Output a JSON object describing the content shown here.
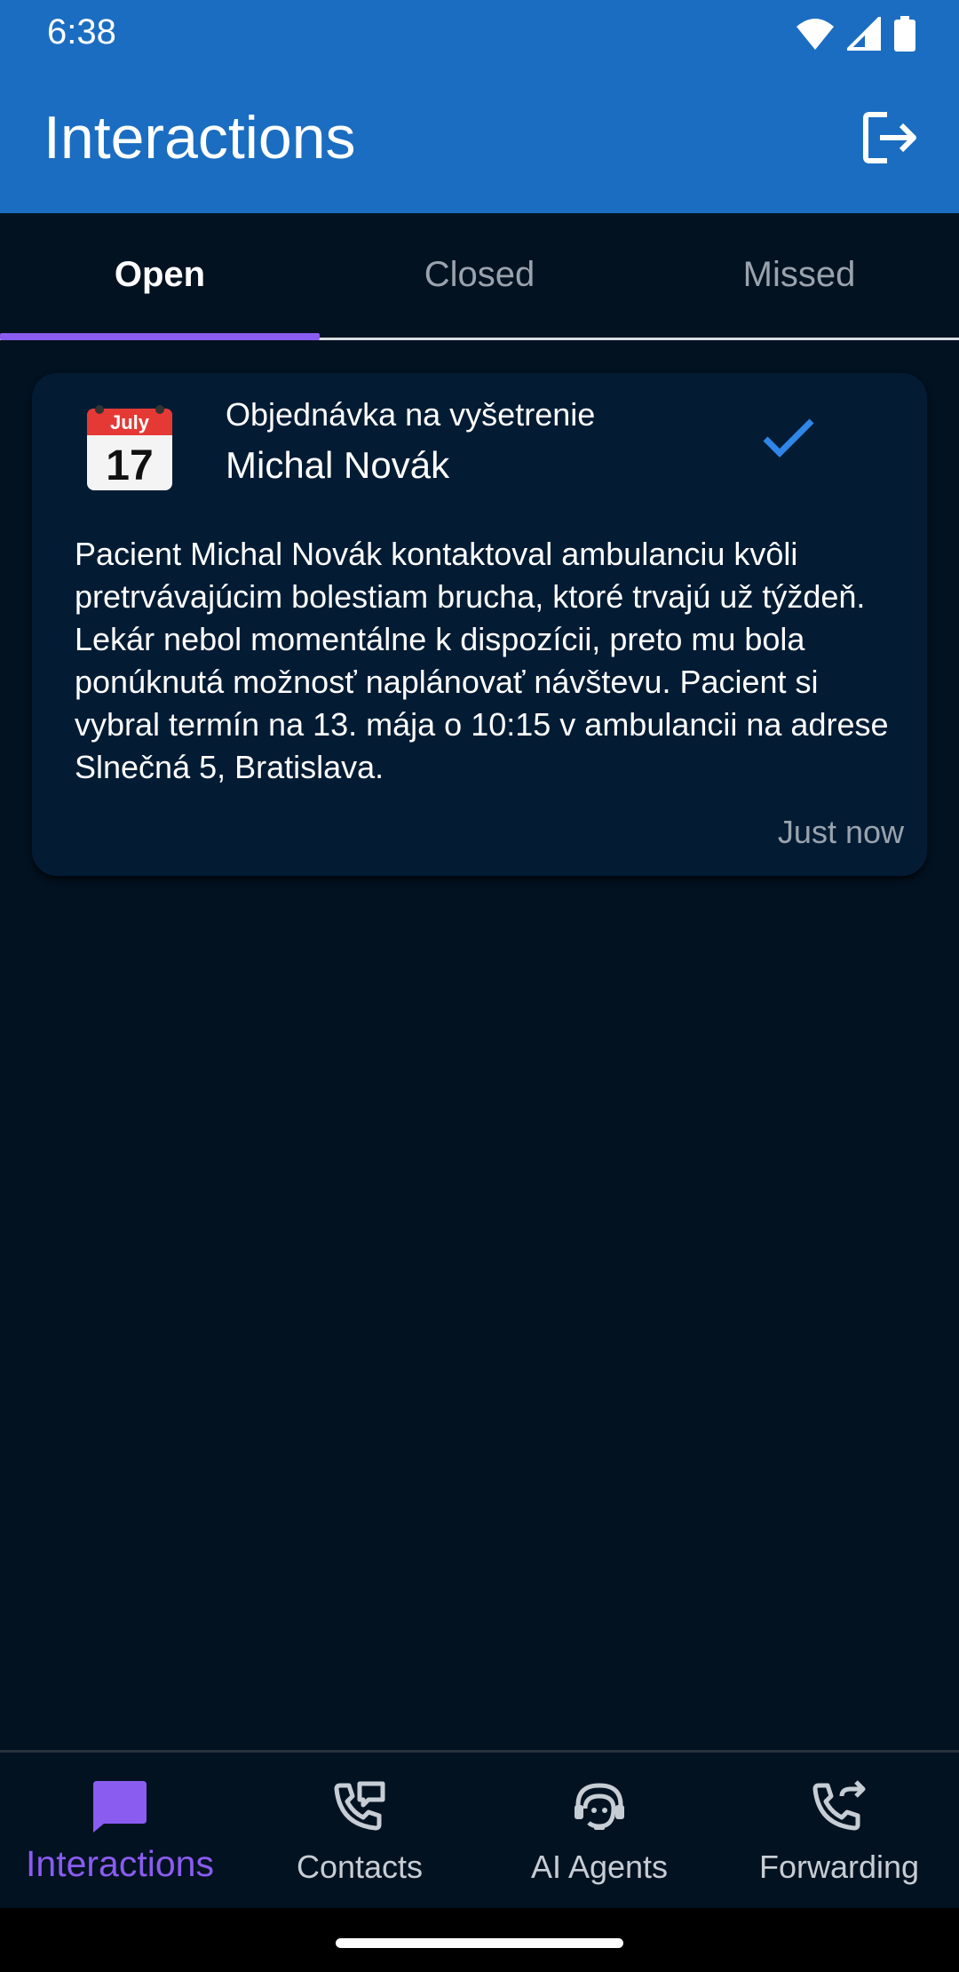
{
  "status_bar": {
    "time": "6:38"
  },
  "app_bar": {
    "title": "Interactions"
  },
  "tabs": [
    {
      "label": "Open"
    },
    {
      "label": "Closed"
    },
    {
      "label": "Missed"
    }
  ],
  "card": {
    "calendar_month": "July",
    "calendar_day": "17",
    "subject": "Objednávka na vyšetrenie",
    "name": "Michal Novák",
    "body": "Pacient Michal Novák kontaktoval ambulanciu kvôli pretrvávajúcim bolestiam brucha, ktoré trvajú už týždeň. Lekár nebol momentálne k dispozícii, preto mu bola ponúknutá možnosť naplánovať návštevu. Pacient si vybral termín na 13. mája o 10:15 v ambulancii na adrese Slnečná 5, Bratislava.",
    "time": "Just now"
  },
  "bottom_nav": [
    {
      "label": "Interactions",
      "icon": "chat-icon"
    },
    {
      "label": "Contacts",
      "icon": "contact-phone-icon"
    },
    {
      "label": "AI Agents",
      "icon": "support-agent-icon"
    },
    {
      "label": "Forwarding",
      "icon": "phone-forward-icon"
    }
  ],
  "colors": {
    "app_bar": "#1b6dc1",
    "background": "#021221",
    "card": "#031c34",
    "accent": "#8a5cf0",
    "check": "#2f86e8"
  }
}
